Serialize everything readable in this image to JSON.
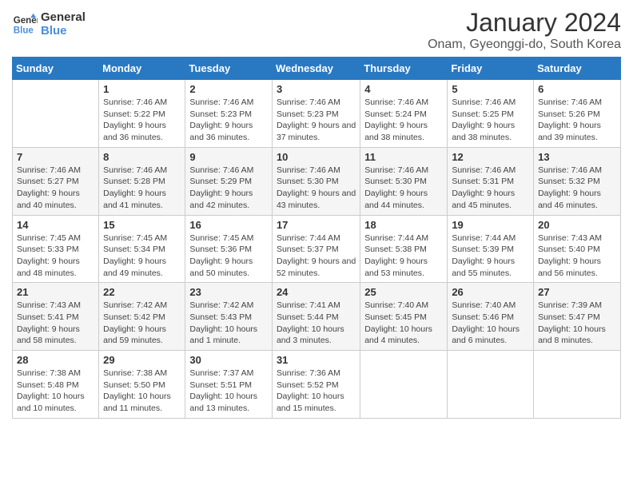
{
  "header": {
    "logo_line1": "General",
    "logo_line2": "Blue",
    "title": "January 2024",
    "subtitle": "Onam, Gyeonggi-do, South Korea"
  },
  "weekdays": [
    "Sunday",
    "Monday",
    "Tuesday",
    "Wednesday",
    "Thursday",
    "Friday",
    "Saturday"
  ],
  "weeks": [
    [
      {
        "day": "",
        "sunrise": "",
        "sunset": "",
        "daylight": ""
      },
      {
        "day": "1",
        "sunrise": "Sunrise: 7:46 AM",
        "sunset": "Sunset: 5:22 PM",
        "daylight": "Daylight: 9 hours and 36 minutes."
      },
      {
        "day": "2",
        "sunrise": "Sunrise: 7:46 AM",
        "sunset": "Sunset: 5:23 PM",
        "daylight": "Daylight: 9 hours and 36 minutes."
      },
      {
        "day": "3",
        "sunrise": "Sunrise: 7:46 AM",
        "sunset": "Sunset: 5:23 PM",
        "daylight": "Daylight: 9 hours and 37 minutes."
      },
      {
        "day": "4",
        "sunrise": "Sunrise: 7:46 AM",
        "sunset": "Sunset: 5:24 PM",
        "daylight": "Daylight: 9 hours and 38 minutes."
      },
      {
        "day": "5",
        "sunrise": "Sunrise: 7:46 AM",
        "sunset": "Sunset: 5:25 PM",
        "daylight": "Daylight: 9 hours and 38 minutes."
      },
      {
        "day": "6",
        "sunrise": "Sunrise: 7:46 AM",
        "sunset": "Sunset: 5:26 PM",
        "daylight": "Daylight: 9 hours and 39 minutes."
      }
    ],
    [
      {
        "day": "7",
        "sunrise": "Sunrise: 7:46 AM",
        "sunset": "Sunset: 5:27 PM",
        "daylight": "Daylight: 9 hours and 40 minutes."
      },
      {
        "day": "8",
        "sunrise": "Sunrise: 7:46 AM",
        "sunset": "Sunset: 5:28 PM",
        "daylight": "Daylight: 9 hours and 41 minutes."
      },
      {
        "day": "9",
        "sunrise": "Sunrise: 7:46 AM",
        "sunset": "Sunset: 5:29 PM",
        "daylight": "Daylight: 9 hours and 42 minutes."
      },
      {
        "day": "10",
        "sunrise": "Sunrise: 7:46 AM",
        "sunset": "Sunset: 5:30 PM",
        "daylight": "Daylight: 9 hours and 43 minutes."
      },
      {
        "day": "11",
        "sunrise": "Sunrise: 7:46 AM",
        "sunset": "Sunset: 5:30 PM",
        "daylight": "Daylight: 9 hours and 44 minutes."
      },
      {
        "day": "12",
        "sunrise": "Sunrise: 7:46 AM",
        "sunset": "Sunset: 5:31 PM",
        "daylight": "Daylight: 9 hours and 45 minutes."
      },
      {
        "day": "13",
        "sunrise": "Sunrise: 7:46 AM",
        "sunset": "Sunset: 5:32 PM",
        "daylight": "Daylight: 9 hours and 46 minutes."
      }
    ],
    [
      {
        "day": "14",
        "sunrise": "Sunrise: 7:45 AM",
        "sunset": "Sunset: 5:33 PM",
        "daylight": "Daylight: 9 hours and 48 minutes."
      },
      {
        "day": "15",
        "sunrise": "Sunrise: 7:45 AM",
        "sunset": "Sunset: 5:34 PM",
        "daylight": "Daylight: 9 hours and 49 minutes."
      },
      {
        "day": "16",
        "sunrise": "Sunrise: 7:45 AM",
        "sunset": "Sunset: 5:36 PM",
        "daylight": "Daylight: 9 hours and 50 minutes."
      },
      {
        "day": "17",
        "sunrise": "Sunrise: 7:44 AM",
        "sunset": "Sunset: 5:37 PM",
        "daylight": "Daylight: 9 hours and 52 minutes."
      },
      {
        "day": "18",
        "sunrise": "Sunrise: 7:44 AM",
        "sunset": "Sunset: 5:38 PM",
        "daylight": "Daylight: 9 hours and 53 minutes."
      },
      {
        "day": "19",
        "sunrise": "Sunrise: 7:44 AM",
        "sunset": "Sunset: 5:39 PM",
        "daylight": "Daylight: 9 hours and 55 minutes."
      },
      {
        "day": "20",
        "sunrise": "Sunrise: 7:43 AM",
        "sunset": "Sunset: 5:40 PM",
        "daylight": "Daylight: 9 hours and 56 minutes."
      }
    ],
    [
      {
        "day": "21",
        "sunrise": "Sunrise: 7:43 AM",
        "sunset": "Sunset: 5:41 PM",
        "daylight": "Daylight: 9 hours and 58 minutes."
      },
      {
        "day": "22",
        "sunrise": "Sunrise: 7:42 AM",
        "sunset": "Sunset: 5:42 PM",
        "daylight": "Daylight: 9 hours and 59 minutes."
      },
      {
        "day": "23",
        "sunrise": "Sunrise: 7:42 AM",
        "sunset": "Sunset: 5:43 PM",
        "daylight": "Daylight: 10 hours and 1 minute."
      },
      {
        "day": "24",
        "sunrise": "Sunrise: 7:41 AM",
        "sunset": "Sunset: 5:44 PM",
        "daylight": "Daylight: 10 hours and 3 minutes."
      },
      {
        "day": "25",
        "sunrise": "Sunrise: 7:40 AM",
        "sunset": "Sunset: 5:45 PM",
        "daylight": "Daylight: 10 hours and 4 minutes."
      },
      {
        "day": "26",
        "sunrise": "Sunrise: 7:40 AM",
        "sunset": "Sunset: 5:46 PM",
        "daylight": "Daylight: 10 hours and 6 minutes."
      },
      {
        "day": "27",
        "sunrise": "Sunrise: 7:39 AM",
        "sunset": "Sunset: 5:47 PM",
        "daylight": "Daylight: 10 hours and 8 minutes."
      }
    ],
    [
      {
        "day": "28",
        "sunrise": "Sunrise: 7:38 AM",
        "sunset": "Sunset: 5:48 PM",
        "daylight": "Daylight: 10 hours and 10 minutes."
      },
      {
        "day": "29",
        "sunrise": "Sunrise: 7:38 AM",
        "sunset": "Sunset: 5:50 PM",
        "daylight": "Daylight: 10 hours and 11 minutes."
      },
      {
        "day": "30",
        "sunrise": "Sunrise: 7:37 AM",
        "sunset": "Sunset: 5:51 PM",
        "daylight": "Daylight: 10 hours and 13 minutes."
      },
      {
        "day": "31",
        "sunrise": "Sunrise: 7:36 AM",
        "sunset": "Sunset: 5:52 PM",
        "daylight": "Daylight: 10 hours and 15 minutes."
      },
      {
        "day": "",
        "sunrise": "",
        "sunset": "",
        "daylight": ""
      },
      {
        "day": "",
        "sunrise": "",
        "sunset": "",
        "daylight": ""
      },
      {
        "day": "",
        "sunrise": "",
        "sunset": "",
        "daylight": ""
      }
    ]
  ]
}
